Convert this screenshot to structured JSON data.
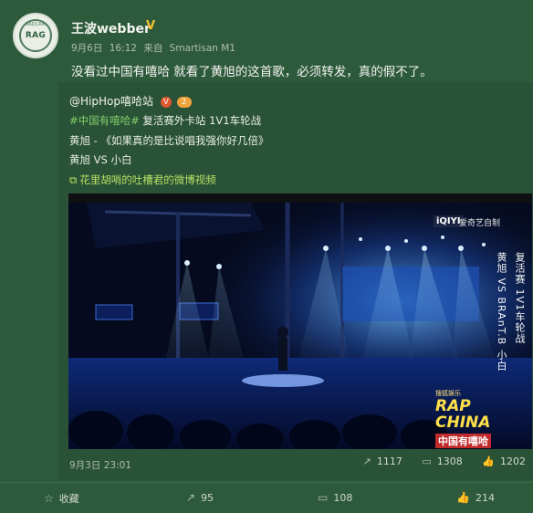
{
  "header": {
    "avatar_text": "RAG",
    "avatar_sub": "RADCAM",
    "username": "王波webber",
    "verified_icon": "V",
    "meta": {
      "date": "9月6日",
      "time": "16:12",
      "source_prefix": "来自",
      "device": "Smartisan M1"
    },
    "text": "没看过中国有嘻哈 就看了黄旭的这首歌，必须转发，真的假不了。"
  },
  "repost": {
    "handle": "@HipHop嘻哈站",
    "badge_v": "V",
    "badge_level": "2",
    "hashtag": "#中国有嘻哈#",
    "line1_rest": " 复活赛外卡站 1V1车轮战",
    "line2": "黄旭 - 《如果真的是比说唱我强你好几倍》",
    "line3": "黄旭 VS 小白",
    "video_link": "花里胡哨的吐槽君的微博视频",
    "video": {
      "logo": "iQIYI",
      "logo_sub": "爱奇艺自制",
      "caption_col1": "复活赛 1V1车轮战",
      "caption_col2": "黄旭 VS BRAnT.B 小白",
      "show_top": "搜狐娱乐",
      "show_main": "RAP CHINA",
      "show_cn": "中国有嘻哈"
    },
    "date": "9月3日 23:01",
    "actions": {
      "repost_count": "1117",
      "comment_count": "1308",
      "like_count": "1202"
    }
  },
  "bottom_bar": {
    "favorite_label": "收藏",
    "repost_count": "95",
    "comment_count": "108",
    "like_count": "214"
  },
  "colors": {
    "background": "#2e5a3c",
    "hashtag": "#7fd06a",
    "link": "#b7e066"
  }
}
